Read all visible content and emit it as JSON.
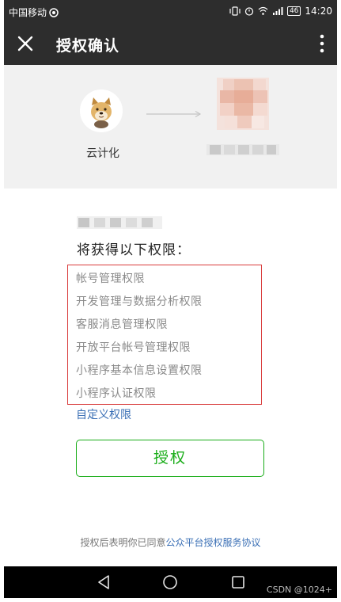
{
  "status_bar": {
    "carrier": "中国移动",
    "time": "14:20",
    "battery": "46"
  },
  "title_bar": {
    "title": "授权确认",
    "close_icon": "close-icon",
    "more_icon": "more-vertical-icon"
  },
  "header": {
    "app_name": "云计化",
    "app_avatar_icon": "doge-avatar-icon",
    "arrow_icon": "arrow-right-icon"
  },
  "permissions": {
    "heading": "将获得以下权限：",
    "items": [
      "帐号管理权限",
      "开发管理与数据分析权限",
      "客服消息管理权限",
      "开放平台帐号管理权限",
      "小程序基本信息设置权限",
      "小程序认证权限"
    ],
    "custom_link": "自定义权限"
  },
  "actions": {
    "authorize_label": "授权"
  },
  "footer": {
    "prefix": "授权后表明你已同意",
    "link": "公众平台授权服务协议"
  },
  "nav": {
    "back_icon": "back-triangle-icon",
    "home_icon": "home-circle-icon",
    "recents_icon": "recents-square-icon"
  },
  "watermark": "CSDN @1024+",
  "colors": {
    "bar_bg": "#2d2d2d",
    "header_bg": "#f1f1f1",
    "accent_green": "#1aad19",
    "link_blue": "#3a6fb5",
    "highlight_red": "#d93d3d"
  }
}
